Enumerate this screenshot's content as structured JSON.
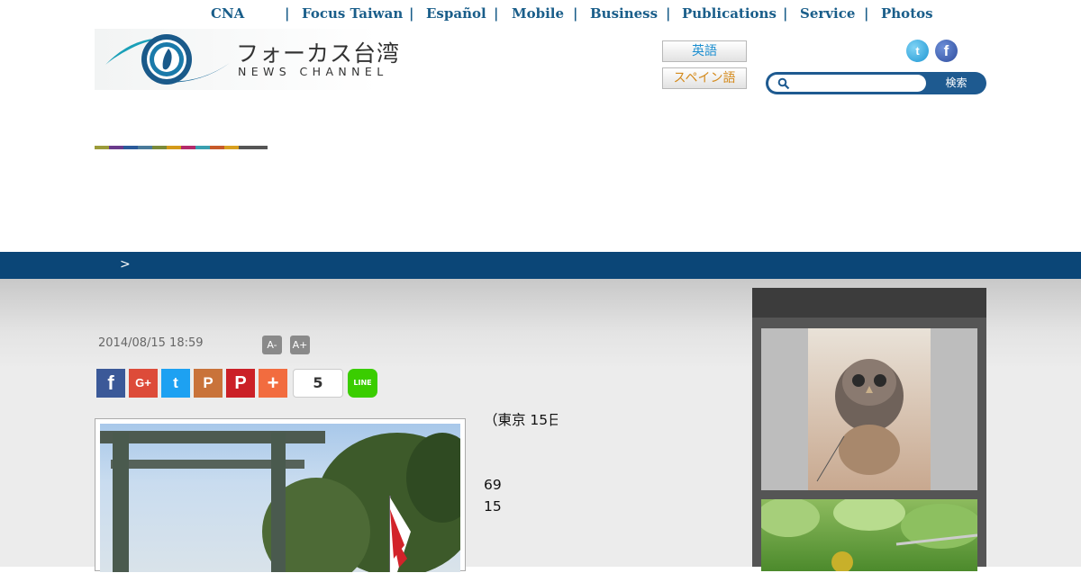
{
  "top_nav": {
    "items": [
      "CNA",
      "|",
      "Focus Taiwan",
      "|",
      "Español",
      "|",
      "Mobile",
      "|",
      "Business",
      "|",
      "Publications",
      "|",
      "Service",
      "|",
      "Photos"
    ]
  },
  "logo": {
    "title_jp": "フォーカス台湾",
    "subtitle_en": "NEWS CHANNEL"
  },
  "language_buttons": {
    "english": "英語",
    "spanish": "スペイン語"
  },
  "social_header": {
    "twitter_icon": "t",
    "facebook_icon": "f"
  },
  "search": {
    "placeholder": "",
    "button_label": "検索"
  },
  "colorbar": [
    "#9b9b3a",
    "#6a3a8b",
    "#2a5a9a",
    "#4a7a9a",
    "#7a8a3a",
    "#d49a1a",
    "#b42a6a",
    "#3aa0b0",
    "#c75a2a",
    "#d8a020",
    "#555555",
    "#555555"
  ],
  "breadcrumb": {
    "separator": ">"
  },
  "article": {
    "timestamp": "2014/08/15 18:59",
    "font_smaller": "A-",
    "font_larger": "A+",
    "share_count": "5",
    "line_label": "LINE",
    "text_lines": [
      "（東京 15日",
      "　　　　　　　　",
      "　　　　　　　　",
      "69　　　　　",
      "15　　　　　　",
      "　　　　　　　　",
      "　　　　　　　　",
      "　　　　　　　　"
    ]
  },
  "share_buttons": {
    "facebook": "f",
    "googleplus": "G+",
    "twitter": "t",
    "plurk": "P",
    "pinterest": "P",
    "addthis": "+"
  },
  "sidebar": {
    "title": ""
  }
}
